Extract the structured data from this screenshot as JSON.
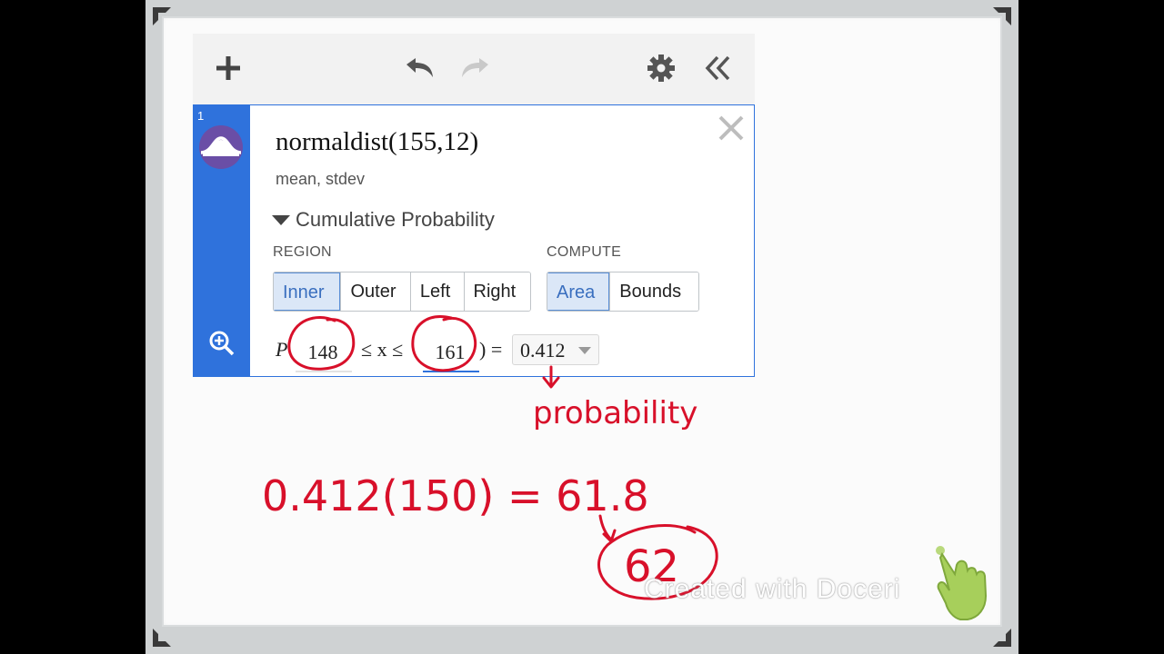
{
  "toolbar": {
    "add_icon": "plus-icon",
    "undo_icon": "undo-icon",
    "redo_icon": "redo-icon",
    "settings_icon": "gear-icon",
    "collapse_icon": "double-chevron-left-icon"
  },
  "expression": {
    "index": "1",
    "function": "normaldist(155,12)",
    "params_hint": "mean, stdev",
    "section": "Cumulative Probability",
    "region_label": "REGION",
    "region_options": [
      "Inner",
      "Outer",
      "Left",
      "Right"
    ],
    "region_selected": "Inner",
    "compute_label": "COMPUTE",
    "compute_options": [
      "Area",
      "Bounds"
    ],
    "compute_selected": "Area",
    "prob_prefix": "P",
    "lower_bound": "148",
    "leq_x_leq": "≤ x ≤",
    "upper_bound": "161",
    "close_paren_eq": ") =",
    "result": "0.412"
  },
  "annotations": {
    "arrow_label": "probability",
    "equation": "0.412(150) = 61.8",
    "rounded": "62"
  },
  "watermark": "Created with Doceri",
  "colors": {
    "accent_blue": "#2f72dc",
    "ink_red": "#d8102a",
    "selected_bg": "#dbe7f7"
  }
}
